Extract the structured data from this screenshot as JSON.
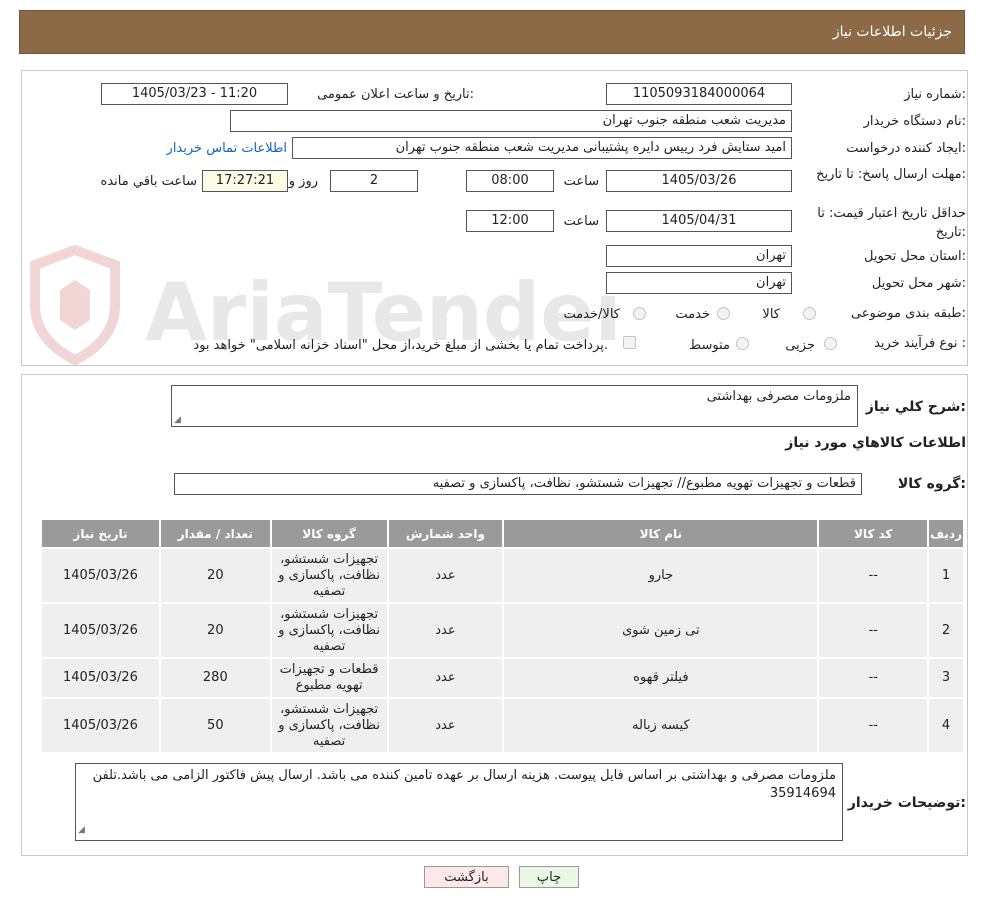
{
  "page_title": "جزئیات اطلاعات نیاز",
  "fields": {
    "need_number_label": "شماره نیاز:",
    "need_number": "1105093184000064",
    "announce_label": "تاریخ و ساعت اعلان عمومی:",
    "announce_value": "1405/03/23 - 11:20",
    "buyer_org_label": "نام دستگاه خریدار:",
    "buyer_org": "مدیریت شعب منطقه جنوب تهران",
    "creator_label": "ایجاد کننده درخواست:",
    "creator": "امید ستایش فرد رییس دایره پشتیبانی مدیریت شعب منطقه جنوب تهران",
    "contact_link": "اطلاعات تماس خریدار",
    "reply_deadline_label": "مهلت ارسال پاسخ: تا تاریخ:",
    "reply_date": "1405/03/26",
    "time_label": "ساعت",
    "reply_time": "08:00",
    "days_value": "2",
    "days_label": "روز و",
    "remaining_time": "17:27:21",
    "remaining_label": "ساعت باقي مانده",
    "price_validity_label": "حداقل تاریخ اعتبار قیمت: تا تاریخ:",
    "price_date": "1405/04/31",
    "price_time": "12:00",
    "province_label": "استان محل تحویل:",
    "province": "تهران",
    "city_label": "شهر محل تحویل:",
    "city": "تهران",
    "category_label": "طبقه بندی موضوعی:",
    "category_options": [
      "کالا",
      "خدمت",
      "کالا/خدمت"
    ],
    "process_label": "نوع فرآیند خرید :",
    "process_options": [
      "جزیی",
      "متوسط"
    ],
    "payment_note": "پرداخت تمام یا بخشی از مبلغ خرید،از محل \"اسناد خزانه اسلامی\" خواهد بود."
  },
  "summary": {
    "label": "شرح کلي نياز:",
    "value": "ملزومات مصرفی بهداشتی",
    "goods_info_title": "اطلاعات كالاهاي مورد نياز",
    "group_label": "گروه کالا:",
    "group_value": "قطعات و تجهیزات تهویه مطبوع// تجهیزات شستشو، نظافت، پاکسازی و تصفیه"
  },
  "table": {
    "headers": [
      "رديف",
      "کد کالا",
      "نام کالا",
      "واحد شمارش",
      "گروه کالا",
      "تعداد / مقدار",
      "تاریخ نیاز"
    ],
    "rows": [
      {
        "row": "1",
        "code": "--",
        "name": "جارو",
        "unit": "عدد",
        "group": "تجهیزات شستشو، نظافت، پاکسازی و تصفیه",
        "qty": "20",
        "date": "1405/03/26"
      },
      {
        "row": "2",
        "code": "--",
        "name": "تی زمین شوی",
        "unit": "عدد",
        "group": "تجهیزات شستشو، نظافت، پاکسازی و تصفیه",
        "qty": "20",
        "date": "1405/03/26"
      },
      {
        "row": "3",
        "code": "--",
        "name": "فیلتر قهوه",
        "unit": "عدد",
        "group": "قطعات و تجهیزات تهویه مطبوع",
        "qty": "280",
        "date": "1405/03/26"
      },
      {
        "row": "4",
        "code": "--",
        "name": "کیسه زباله",
        "unit": "عدد",
        "group": "تجهیزات شستشو، نظافت، پاکسازی و تصفیه",
        "qty": "50",
        "date": "1405/03/26"
      }
    ]
  },
  "buyer_notes": {
    "label": "توضیحات خریدار:",
    "value": "ملزومات مصرفی و بهداشتی بر اساس فایل پیوست. هزینه ارسال بر عهده تامین کننده می باشد. ارسال پیش فاکتور الزامی می باشد.تلفن 35914694"
  },
  "buttons": {
    "print": "چاپ",
    "back": "بازگشت"
  },
  "watermark_text": "AriaTender.neT",
  "colors": {
    "header_bg": "#8b6a45",
    "table_header_bg": "#9a9a9a",
    "link": "#1565c0",
    "back_button_bg": "#fde8e8",
    "print_button_bg": "#eaf7e4"
  }
}
